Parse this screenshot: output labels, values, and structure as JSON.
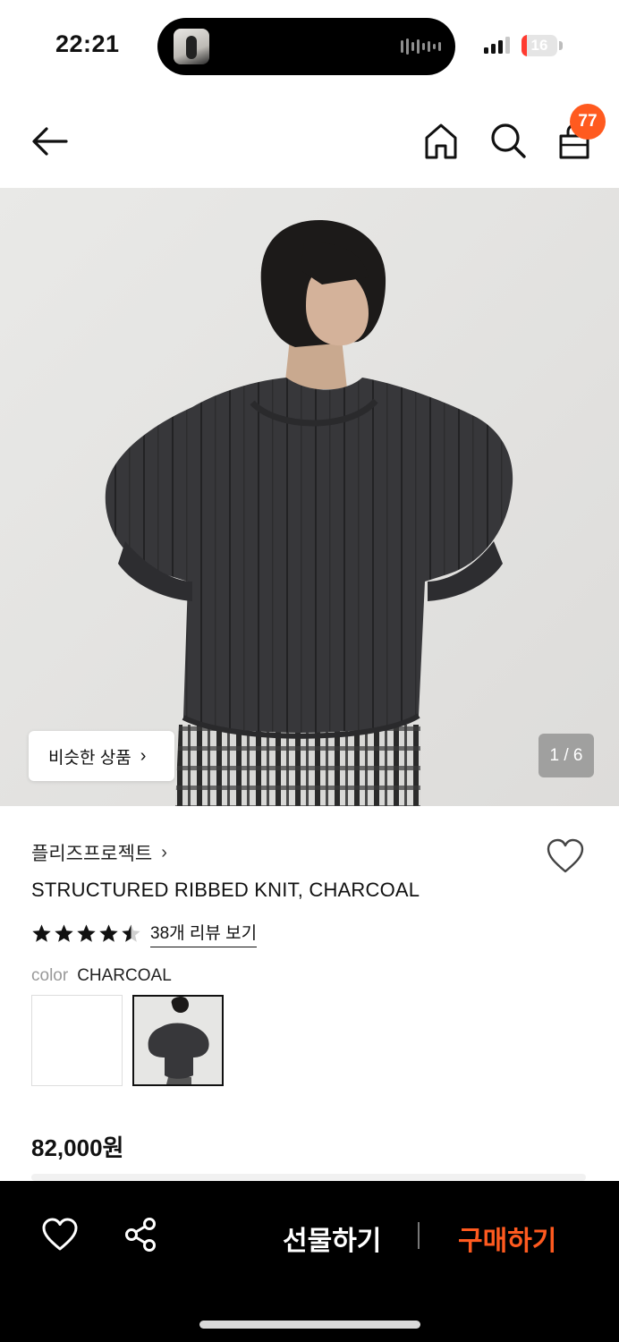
{
  "status_bar": {
    "time": "22:21",
    "battery": "16",
    "battery_level_percent": 16
  },
  "nav": {
    "cart_count": "77",
    "icons": [
      "back-arrow-icon",
      "home-icon",
      "search-icon",
      "shopping-bag-icon"
    ]
  },
  "gallery": {
    "similar_label": "비슷한 상품",
    "pager": "1 / 6"
  },
  "product": {
    "brand": "플리즈프로젝트",
    "title": "STRUCTURED RIBBED KNIT, CHARCOAL",
    "rating": 4.5,
    "review_link": "38개 리뷰 보기",
    "color_label": "color",
    "color_value": "CHARCOAL",
    "price": "82,000원"
  },
  "bottom_bar": {
    "gift_label": "선물하기",
    "buy_label": "구매하기"
  },
  "colors": {
    "accent": "#ff5a1f",
    "bottom_bar_bg": "#000000"
  }
}
